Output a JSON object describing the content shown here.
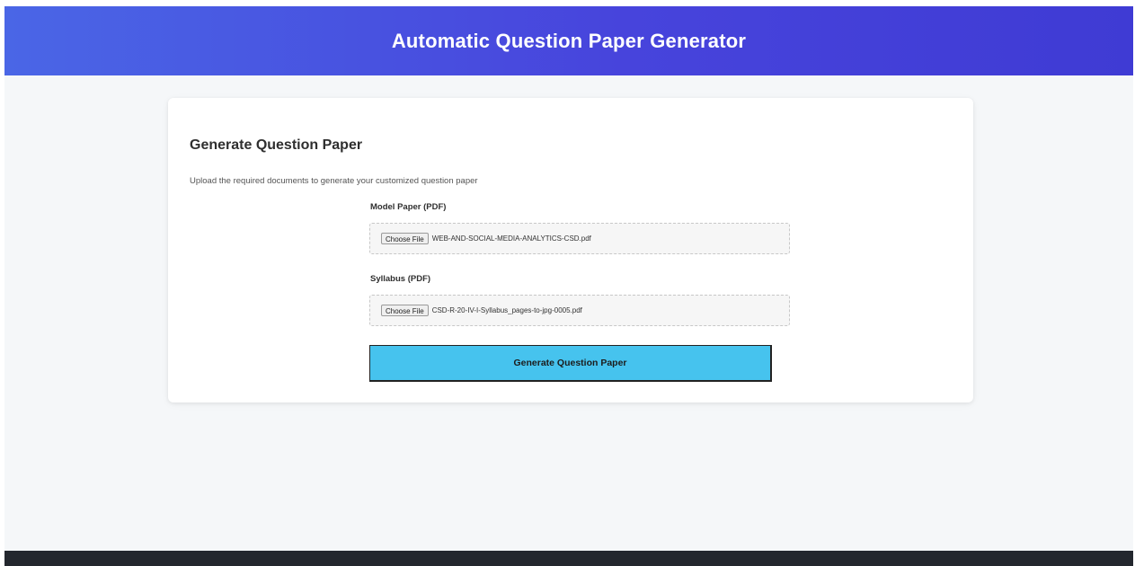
{
  "header": {
    "title": "Automatic Question Paper Generator"
  },
  "card": {
    "title": "Generate Question Paper",
    "subtitle": "Upload the required documents to generate your customized question paper"
  },
  "form": {
    "model_paper": {
      "label": "Model Paper (PDF)",
      "button_label": "Choose File",
      "file_name": "WEB-AND-SOCIAL-MEDIA-ANALYTICS-CSD.pdf"
    },
    "syllabus": {
      "label": "Syllabus (PDF)",
      "button_label": "Choose File",
      "file_name": "CSD-R-20-IV-I-Syllabus_pages-to-jpg-0005.pdf"
    },
    "submit_label": "Generate Question Paper"
  },
  "colors": {
    "header_gradient_start": "#4a66e6",
    "header_gradient_end": "#3f3bd4",
    "button_bg": "#46c3ee",
    "page_bg": "#f5f7f9",
    "footer_bg": "#23272e"
  }
}
